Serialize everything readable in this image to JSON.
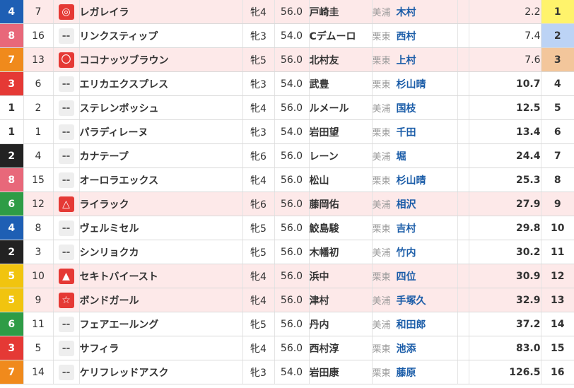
{
  "colors": {
    "waku": {
      "1": "#ffffff",
      "2": "#222222",
      "3": "#e53935",
      "4": "#1e5fb4",
      "5": "#f1c40f",
      "6": "#2e9c46",
      "7": "#f08a1c",
      "8": "#e8687a"
    },
    "waku_text": {
      "1": "#333333",
      "2": "#ffffff",
      "3": "#ffffff",
      "4": "#ffffff",
      "5": "#ffffff",
      "6": "#ffffff",
      "7": "#ffffff",
      "8": "#ffffff"
    },
    "pop_bg": {
      "1": "#fff36b",
      "2": "#bcd3f5",
      "3": "#f3c69b"
    },
    "row_highlight": "#fde9e9"
  },
  "mark_icons": {
    "◎": "double-circle-icon",
    "〇": "circle-icon",
    "△": "triangle-outline-icon",
    "▲": "triangle-filled-icon",
    "☆": "star-outline-icon",
    "--": "no-mark-icon"
  },
  "rows": [
    {
      "waku": "4",
      "uma": "7",
      "mark": "◎",
      "name": "レガレイラ",
      "sex_age": "牝4",
      "weight": "56.0",
      "jockey": "戸崎圭",
      "area": "美浦",
      "trainer": "木村",
      "odds": "2.2",
      "pop": "1",
      "hl": true
    },
    {
      "waku": "8",
      "uma": "16",
      "mark": "--",
      "name": "リンクスティップ",
      "sex_age": "牝3",
      "weight": "54.0",
      "jockey": "Cデムーロ",
      "area": "栗東",
      "trainer": "西村",
      "odds": "7.4",
      "pop": "2",
      "hl": false
    },
    {
      "waku": "7",
      "uma": "13",
      "mark": "〇",
      "name": "ココナッツブラウン",
      "sex_age": "牝5",
      "weight": "56.0",
      "jockey": "北村友",
      "area": "栗東",
      "trainer": "上村",
      "odds": "7.6",
      "pop": "3",
      "hl": true
    },
    {
      "waku": "3",
      "uma": "6",
      "mark": "--",
      "name": "エリカエクスプレス",
      "sex_age": "牝3",
      "weight": "54.0",
      "jockey": "武豊",
      "area": "栗東",
      "trainer": "杉山晴",
      "odds": "10.7",
      "pop": "4",
      "hl": false
    },
    {
      "waku": "1",
      "uma": "2",
      "mark": "--",
      "name": "ステレンボッシュ",
      "sex_age": "牝4",
      "weight": "56.0",
      "jockey": "ルメール",
      "area": "美浦",
      "trainer": "国枝",
      "odds": "12.5",
      "pop": "5",
      "hl": false
    },
    {
      "waku": "1",
      "uma": "1",
      "mark": "--",
      "name": "パラディレーヌ",
      "sex_age": "牝3",
      "weight": "54.0",
      "jockey": "岩田望",
      "area": "栗東",
      "trainer": "千田",
      "odds": "13.4",
      "pop": "6",
      "hl": false
    },
    {
      "waku": "2",
      "uma": "4",
      "mark": "--",
      "name": "カナテープ",
      "sex_age": "牝6",
      "weight": "56.0",
      "jockey": "レーン",
      "area": "美浦",
      "trainer": "堀",
      "odds": "24.4",
      "pop": "7",
      "hl": false
    },
    {
      "waku": "8",
      "uma": "15",
      "mark": "--",
      "name": "オーロラエックス",
      "sex_age": "牝4",
      "weight": "56.0",
      "jockey": "松山",
      "area": "栗東",
      "trainer": "杉山晴",
      "odds": "25.3",
      "pop": "8",
      "hl": false
    },
    {
      "waku": "6",
      "uma": "12",
      "mark": "△",
      "name": "ライラック",
      "sex_age": "牝6",
      "weight": "56.0",
      "jockey": "藤岡佑",
      "area": "美浦",
      "trainer": "相沢",
      "odds": "27.9",
      "pop": "9",
      "hl": true
    },
    {
      "waku": "4",
      "uma": "8",
      "mark": "--",
      "name": "ヴェルミセル",
      "sex_age": "牝5",
      "weight": "56.0",
      "jockey": "鮫島駿",
      "area": "栗東",
      "trainer": "吉村",
      "odds": "29.8",
      "pop": "10",
      "hl": false
    },
    {
      "waku": "2",
      "uma": "3",
      "mark": "--",
      "name": "シンリョクカ",
      "sex_age": "牝5",
      "weight": "56.0",
      "jockey": "木幡初",
      "area": "美浦",
      "trainer": "竹内",
      "odds": "30.2",
      "pop": "11",
      "hl": false
    },
    {
      "waku": "5",
      "uma": "10",
      "mark": "▲",
      "name": "セキトバイースト",
      "sex_age": "牝4",
      "weight": "56.0",
      "jockey": "浜中",
      "area": "栗東",
      "trainer": "四位",
      "odds": "30.9",
      "pop": "12",
      "hl": true
    },
    {
      "waku": "5",
      "uma": "9",
      "mark": "☆",
      "name": "ボンドガール",
      "sex_age": "牝4",
      "weight": "56.0",
      "jockey": "津村",
      "area": "美浦",
      "trainer": "手塚久",
      "odds": "32.9",
      "pop": "13",
      "hl": true
    },
    {
      "waku": "6",
      "uma": "11",
      "mark": "--",
      "name": "フェアエールング",
      "sex_age": "牝5",
      "weight": "56.0",
      "jockey": "丹内",
      "area": "美浦",
      "trainer": "和田郎",
      "odds": "37.2",
      "pop": "14",
      "hl": false
    },
    {
      "waku": "3",
      "uma": "5",
      "mark": "--",
      "name": "サフィラ",
      "sex_age": "牝4",
      "weight": "56.0",
      "jockey": "西村淳",
      "area": "栗東",
      "trainer": "池添",
      "odds": "83.0",
      "pop": "15",
      "hl": false
    },
    {
      "waku": "7",
      "uma": "14",
      "mark": "--",
      "name": "ケリフレッドアスク",
      "sex_age": "牝3",
      "weight": "54.0",
      "jockey": "岩田康",
      "area": "栗東",
      "trainer": "藤原",
      "odds": "126.5",
      "pop": "16",
      "hl": false
    }
  ]
}
